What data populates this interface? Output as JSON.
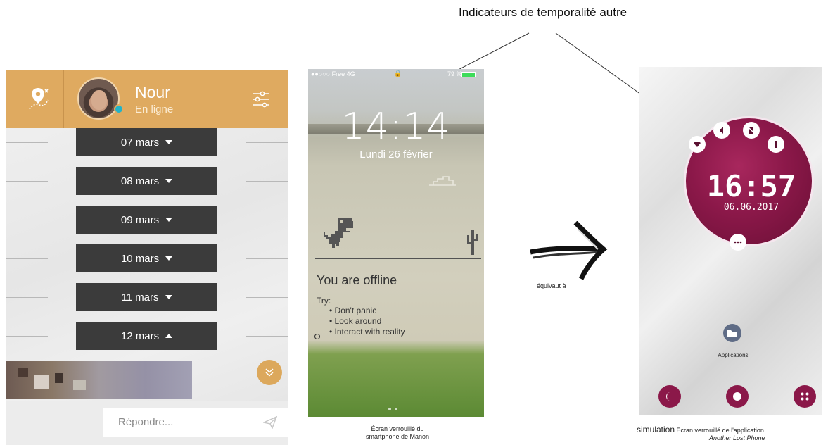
{
  "annotation": {
    "title": "Indicateurs de temporalité autre",
    "equivalence_label": "équivaut à"
  },
  "chat_app": {
    "contact_name": "Nour",
    "contact_status": "En ligne",
    "dates": [
      {
        "label": "07 mars",
        "expanded": false
      },
      {
        "label": "08 mars",
        "expanded": false
      },
      {
        "label": "09 mars",
        "expanded": false
      },
      {
        "label": "10 mars",
        "expanded": false
      },
      {
        "label": "11 mars",
        "expanded": false
      },
      {
        "label": "12 mars",
        "expanded": true
      }
    ],
    "reply_placeholder": "Répondre...",
    "colors": {
      "header": "#dfaa60",
      "date_button": "#3b3b3b",
      "online": "#23b3c7"
    },
    "icons": {
      "map": "map-pin-route-icon",
      "settings": "sliders-icon",
      "expand": "chevron-double-down-icon",
      "send": "send-icon"
    }
  },
  "phone_lockscreen": {
    "carrier": "●●○○○ Free  4G",
    "battery_percent": "79 %",
    "time": "14:14",
    "date": "Lundi 26 février",
    "offline_title": "You are offline",
    "try_label": "Try:",
    "tips": [
      "Don't panic",
      "Look around",
      "Interact with reality"
    ],
    "caption_line1": "Écran verrouillé du",
    "caption_line2": "smartphone de Manon"
  },
  "game_lockscreen": {
    "time": "16:57",
    "date": "06.06.2017",
    "apps_label": "Applications",
    "caption_bold": "simulation",
    "caption_text": "Écran verrouillé de l'application",
    "caption_title": "Another Lost Phone",
    "accent_color": "#8b1849",
    "icons": [
      "wifi-icon",
      "sound-icon",
      "no-sim-icon",
      "battery-icon",
      "more-icon",
      "folder-icon",
      "moon-icon",
      "home-icon",
      "apps-grid-icon"
    ]
  }
}
